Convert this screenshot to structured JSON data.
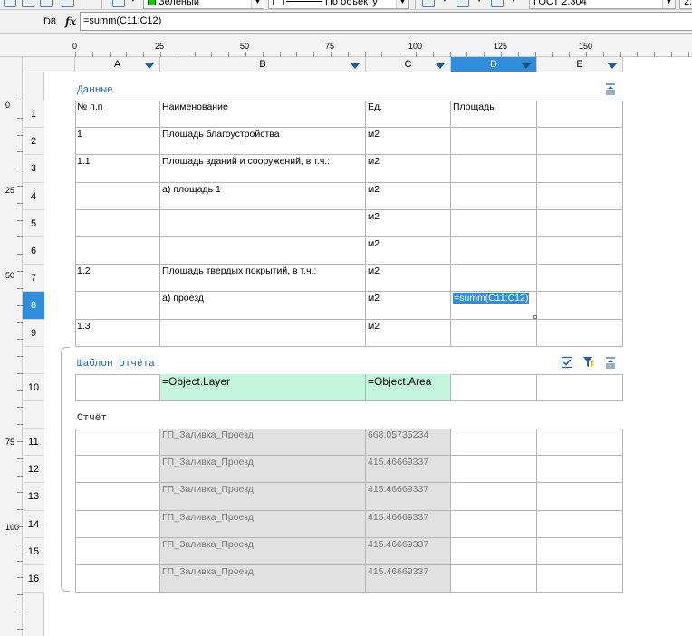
{
  "toolbar": {
    "layer_color_label": "Зеленый",
    "linetype_label": "По объекту",
    "standard_label": "ГОСТ 2.304",
    "size_label": "2."
  },
  "formula_bar": {
    "cell_ref": "D8",
    "fx": "fx",
    "formula": "=summ(C11:C12)"
  },
  "ruler_top": [
    "0",
    "25",
    "50",
    "75",
    "100",
    "125",
    "150"
  ],
  "ruler_left": [
    "0",
    "25",
    "50",
    "75",
    "100"
  ],
  "columns": [
    "A",
    "B",
    "C",
    "D",
    "E"
  ],
  "selected_column": "D",
  "selected_row": "8",
  "sections": {
    "data_title": "Данные",
    "template_title": "Шаблон отчёта",
    "report_title": "Отчёт"
  },
  "data_rows": [
    {
      "row": "1",
      "a": "№ п.п",
      "b": "Наименование",
      "c": "Ед.",
      "d": ""
    },
    {
      "row": "2",
      "a": "1",
      "b": "Площадь благоустройства",
      "c": "м2",
      "d": ""
    },
    {
      "row": "3",
      "a": "1.1",
      "b": "Площадь зданий и сооружений, в т.ч.:",
      "c": "м2",
      "d": ""
    },
    {
      "row": "4",
      "a": "",
      "b": "а) площадь 1",
      "c": "м2",
      "d": ""
    },
    {
      "row": "5",
      "a": "",
      "b": "",
      "c": "м2",
      "d": ""
    },
    {
      "row": "6",
      "a": "",
      "b": "",
      "c": "м2",
      "d": ""
    },
    {
      "row": "7",
      "a": "1.2",
      "b": "Площадь твердых покрытий, в т.ч.:",
      "c": "м2",
      "d": ""
    },
    {
      "row": "8",
      "a": "",
      "b": "а) проезд",
      "c": "м2",
      "d": "=summ(C11:C12)"
    },
    {
      "row": "9",
      "a": "1.3",
      "b": "",
      "c": "м2",
      "d": ""
    }
  ],
  "header_extra": {
    "d1": "Площадь"
  },
  "template_row": {
    "row": "10",
    "b": "=Object.Layer",
    "c": "=Object.Area"
  },
  "report_rows": [
    {
      "row": "11",
      "b": "ГП_Заливка_Проезд",
      "c": "668.05735234"
    },
    {
      "row": "12",
      "b": "ГП_Заливка_Проезд",
      "c": "415.46669337"
    },
    {
      "row": "13",
      "b": "ГП_Заливка_Проезд",
      "c": "415.46669337"
    },
    {
      "row": "14",
      "b": "ГП_Заливка_Проезд",
      "c": "415.46669337"
    },
    {
      "row": "15",
      "b": "ГП_Заливка_Проезд",
      "c": "415.46669337"
    },
    {
      "row": "16",
      "b": "ГП_Заливка_Проезд",
      "c": "415.46669337"
    }
  ],
  "icons": {
    "section_collapse": "collapse-section-icon",
    "checkbox": "checkbox-icon",
    "filter": "filter-icon"
  },
  "colors": {
    "selection": "#2f8ddc",
    "template_fill": "#c5f5dc",
    "report_fill": "#e1e1e1",
    "section_title": "#1f5fa6"
  }
}
